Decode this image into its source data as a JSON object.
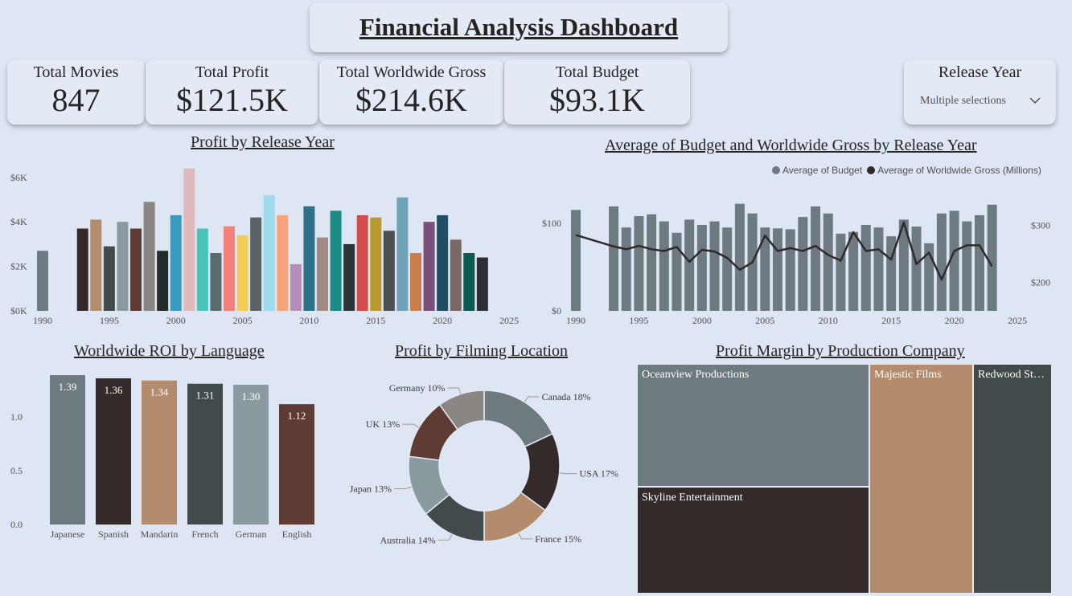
{
  "header": {
    "title": "Financial Analysis Dashboard"
  },
  "kpis": [
    {
      "label": "Total Movies",
      "value": "847"
    },
    {
      "label": "Total Profit",
      "value": "$121.5K"
    },
    {
      "label": "Total Worldwide Gross",
      "value": "$214.6K"
    },
    {
      "label": "Total Budget",
      "value": "$93.1K"
    }
  ],
  "slicer": {
    "label": "Release Year",
    "selection": "Multiple selections",
    "icon": "chevron-down-icon"
  },
  "charts": {
    "profit_by_year_title": "Profit by Release Year",
    "budget_gross_title": "Average of Budget and Worldwide Gross by Release Year",
    "roi_title": "Worldwide ROI by Language",
    "location_title": "Profit by Filming Location",
    "company_title": "Profit Margin by Production Company"
  },
  "legend": {
    "budget": "Average of Budget",
    "gross": "Average of Worldwide Gross (Millions)"
  },
  "colors": {
    "budget_bar": "#6d7a7f",
    "gross_line": "#2e2a2a",
    "axis_text": "#505050"
  },
  "chart_data": [
    {
      "type": "bar",
      "title": "Profit by Release Year",
      "x": [
        1990,
        1993,
        1994,
        1995,
        1996,
        1997,
        1998,
        1999,
        2000,
        2001,
        2002,
        2003,
        2004,
        2005,
        2006,
        2007,
        2008,
        2009,
        2010,
        2011,
        2012,
        2013,
        2014,
        2015,
        2016,
        2017,
        2018,
        2019,
        2020,
        2021,
        2022,
        2023
      ],
      "values": [
        2700,
        3700,
        4100,
        2900,
        4000,
        3700,
        4900,
        2700,
        4300,
        6400,
        3700,
        2600,
        3800,
        3400,
        4200,
        5200,
        4300,
        2100,
        4700,
        3300,
        4500,
        3000,
        4300,
        4200,
        3600,
        5100,
        2600,
        4000,
        4300,
        3200,
        2600,
        2400
      ],
      "colors": [
        "#6d7a7f",
        "#352a2a",
        "#b38b6d",
        "#414b4c",
        "#8a9a9e",
        "#5e3b33",
        "#8a8683",
        "#242b2d",
        "#3a9abf",
        "#e0b9be",
        "#48c5b8",
        "#5a6a6e",
        "#f4807a",
        "#f3cc5a",
        "#596366",
        "#9ddbeb",
        "#f6a47a",
        "#b48eb6",
        "#2e7289",
        "#a08a87",
        "#1c8b86",
        "#2b3537",
        "#d24d4d",
        "#b89a2e",
        "#4b5153",
        "#6ea3b8",
        "#c97d4a",
        "#7a4f7c",
        "#1f4f63",
        "#7a6864",
        "#0a5a50",
        "#2b3034"
      ],
      "ylim": [
        0,
        6500
      ],
      "yticks": [
        "$0K",
        "$2K",
        "$4K",
        "$6K"
      ],
      "xticks": [
        "1990",
        "1995",
        "2000",
        "2005",
        "2010",
        "2015",
        "2020",
        "2025"
      ]
    },
    {
      "type": "bar-line",
      "title": "Average of Budget and Worldwide Gross by Release Year",
      "x": [
        1990,
        1993,
        1994,
        1995,
        1996,
        1997,
        1998,
        1999,
        2000,
        2001,
        2002,
        2003,
        2004,
        2005,
        2006,
        2007,
        2008,
        2009,
        2010,
        2011,
        2012,
        2013,
        2014,
        2015,
        2016,
        2017,
        2018,
        2019,
        2020,
        2021,
        2022,
        2023
      ],
      "series": [
        {
          "name": "Average of Budget",
          "kind": "bar",
          "values": [
            115,
            119,
            95,
            108,
            110,
            102,
            89,
            104,
            98,
            102,
            95,
            122,
            111,
            95,
            94,
            93,
            107,
            119,
            111,
            88,
            90,
            98,
            95,
            85,
            104,
            96,
            77,
            111,
            114,
            102,
            109,
            121
          ]
        },
        {
          "name": "Average of Worldwide Gross (Millions)",
          "kind": "line",
          "values": [
            283,
            263,
            258,
            264,
            258,
            255,
            262,
            236,
            257,
            254,
            243,
            222,
            235,
            282,
            255,
            260,
            255,
            264,
            248,
            238,
            288,
            255,
            258,
            240,
            305,
            232,
            252,
            205,
            255,
            265,
            265,
            228
          ]
        }
      ],
      "ylim_left": [
        0,
        130
      ],
      "ylim_right": [
        150,
        350
      ],
      "yticks_left": [
        "$0",
        "$100"
      ],
      "yticks_right": [
        "$200",
        "$300"
      ],
      "xticks": [
        "1990",
        "1995",
        "2000",
        "2005",
        "2010",
        "2015",
        "2020",
        "2025"
      ]
    },
    {
      "type": "bar",
      "title": "Worldwide ROI by Language",
      "categories": [
        "Japanese",
        "Spanish",
        "Mandarin",
        "French",
        "German",
        "English"
      ],
      "values": [
        1.39,
        1.36,
        1.34,
        1.31,
        1.3,
        1.12
      ],
      "colors": [
        "#6d7a7f",
        "#352a2a",
        "#b38b6d",
        "#414b4c",
        "#8a9a9e",
        "#5e3b33"
      ],
      "ylim": [
        0,
        1.45
      ],
      "yticks": [
        "0.0",
        "0.5",
        "1.0"
      ]
    },
    {
      "type": "pie",
      "title": "Profit by Filming Location",
      "labels": [
        "Canada 18%",
        "USA 17%",
        "France 15%",
        "Australia 14%",
        "Japan 13%",
        "UK 13%",
        "Germany 10%"
      ],
      "values": [
        18,
        17,
        15,
        14,
        13,
        13,
        10
      ],
      "colors": [
        "#6d7a7f",
        "#352a2a",
        "#b38b6d",
        "#414b4c",
        "#8a9a9e",
        "#5e3b33",
        "#8a8683"
      ]
    },
    {
      "type": "treemap",
      "title": "Profit Margin by Production Company",
      "labels": [
        "Oceanview Productions",
        "Skyline Entertainment",
        "Majestic Films",
        "Redwood St…"
      ],
      "colors": [
        "#6d7a7f",
        "#352a2a",
        "#b38b6d",
        "#414b4c"
      ]
    }
  ]
}
